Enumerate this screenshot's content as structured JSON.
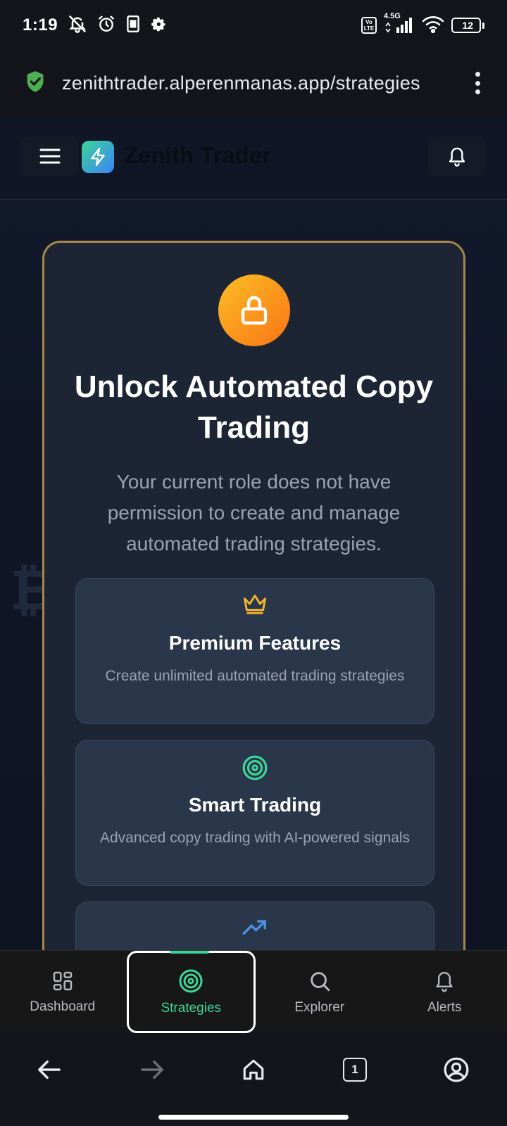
{
  "status_bar": {
    "time": "1:19",
    "network_label_top": "4.5G",
    "volte_label": "Vo LTE",
    "battery_level": "12"
  },
  "browser": {
    "url": "zenithtrader.alperenmanas.app/strategies",
    "tab_count": "1"
  },
  "app": {
    "name": "Zenith Trader"
  },
  "lock_card": {
    "title": "Unlock Automated Copy Trading",
    "description": "Your current role does not have permission to create and manage automated trading strategies.",
    "features": [
      {
        "icon": "crown-icon",
        "title": "Premium Features",
        "description": "Create unlimited automated trading strategies"
      },
      {
        "icon": "target-icon",
        "title": "Smart Trading",
        "description": "Advanced copy trading with AI-powered signals"
      },
      {
        "icon": "trending-up-icon",
        "title": "",
        "description": ""
      }
    ]
  },
  "bottom_nav": {
    "items": [
      {
        "label": "Dashboard",
        "icon": "dashboard-grid-icon",
        "active": false
      },
      {
        "label": "Strategies",
        "icon": "target-icon",
        "active": true
      },
      {
        "label": "Explorer",
        "icon": "search-icon",
        "active": false
      },
      {
        "label": "Alerts",
        "icon": "bell-icon",
        "active": false
      }
    ]
  },
  "colors": {
    "accent_green": "#3dd598",
    "gold_border": "#a8874a",
    "crown_gold": "#f5b72a",
    "trend_blue": "#4a90e2",
    "lock_orange": "#f97316"
  }
}
